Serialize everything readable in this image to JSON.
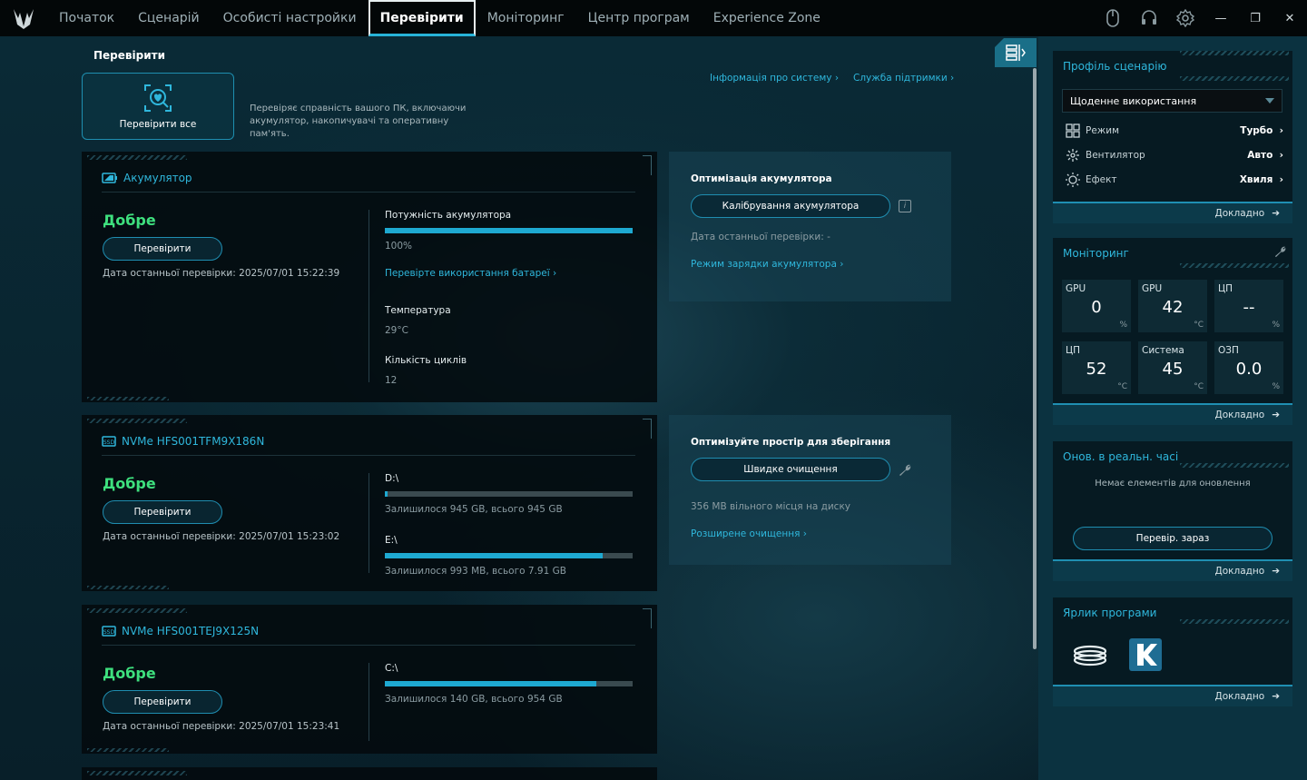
{
  "nav": {
    "items": [
      "Початок",
      "Сценарій",
      "Особисті настройки",
      "Перевірити",
      "Моніторинг",
      "Центр програм",
      "Experience Zone"
    ],
    "active_index": 3
  },
  "page": {
    "title": "Перевірити",
    "check_all_label": "Перевірити все",
    "intro": "Перевіряє справність вашого ПК, включаючи акумулятор, накопичувачі та оперативну пам'ять.",
    "system_info_link": "Інформація про систему",
    "support_link": "Служба підтримки"
  },
  "battery": {
    "title": "Акумулятор",
    "status": "Добре",
    "check_label": "Перевірити",
    "last_check": "Дата останньої перевірки: 2025/07/01 15:22:39",
    "power_label": "Потужність акумулятора",
    "power_value": "100%",
    "power_percent": 100,
    "usage_link": "Перевірте використання батареї",
    "temp_label": "Температура",
    "temp_value": "29°C",
    "cycles_label": "Кількість циклів",
    "cycles_value": "12"
  },
  "battery_opt": {
    "title": "Оптимізація акумулятора",
    "calibrate_label": "Калібрування акумулятора",
    "last_check": "Дата останньої перевірки: -",
    "charge_mode_link": "Режим зарядки акумулятора"
  },
  "drive1": {
    "title": "NVMe HFS001TFM9X186N",
    "status": "Добре",
    "check_label": "Перевірити",
    "last_check": "Дата останньої перевірки: 2025/07/01 15:23:02",
    "volumes": [
      {
        "name": "D:\\",
        "info": "Залишилося 945 GB, всього 945 GB",
        "used_fraction": 0.005
      },
      {
        "name": "E:\\",
        "info": "Залишилося 993 MB, всього 7.91 GB",
        "used_fraction": 0.88
      }
    ]
  },
  "storage_opt": {
    "title": "Оптимізуйте простір для зберігання",
    "quick_clean_label": "Швидке очищення",
    "free_space": "356 MB вільного місця на диску",
    "advanced_link": "Розширене очищення"
  },
  "drive2": {
    "title": "NVMe HFS001TEJ9X125N",
    "status": "Добре",
    "check_label": "Перевірити",
    "last_check": "Дата останньої перевірки: 2025/07/01 15:23:41",
    "volumes": [
      {
        "name": "C:\\",
        "info": "Залишилося 140 GB, всього 954 GB",
        "used_fraction": 0.853
      }
    ]
  },
  "right": {
    "profile": {
      "title": "Профіль сценарію",
      "selected": "Щоденне використання",
      "rows": [
        {
          "label": "Режим",
          "value": "Турбо",
          "icon": "grid-icon"
        },
        {
          "label": "Вентилятор",
          "value": "Авто",
          "icon": "fan-icon"
        },
        {
          "label": "Ефект",
          "value": "Хвиля",
          "icon": "light-effect-icon"
        }
      ],
      "more": "Докладно"
    },
    "monitoring": {
      "title": "Моніторинг",
      "tiles": [
        {
          "label": "GPU",
          "value": "0",
          "unit": "%"
        },
        {
          "label": "GPU",
          "value": "42",
          "unit": "°C"
        },
        {
          "label": "ЦП",
          "value": "--",
          "unit": "%"
        },
        {
          "label": "ЦП",
          "value": "52",
          "unit": "°C"
        },
        {
          "label": "Система",
          "value": "45",
          "unit": "°C"
        },
        {
          "label": "ОЗП",
          "value": "0.0",
          "unit": "%"
        }
      ],
      "more": "Докладно"
    },
    "updates": {
      "title": "Онов. в реальн. часі",
      "empty": "Немає елементів для оновлення",
      "check_now": "Перевір. зараз",
      "more": "Докладно"
    },
    "shortcuts": {
      "title": "Ярлик програми",
      "more": "Докладно"
    }
  },
  "colors": {
    "accent": "#2fb7dc",
    "good": "#3ee07e",
    "bar": "#1ea9d1"
  }
}
